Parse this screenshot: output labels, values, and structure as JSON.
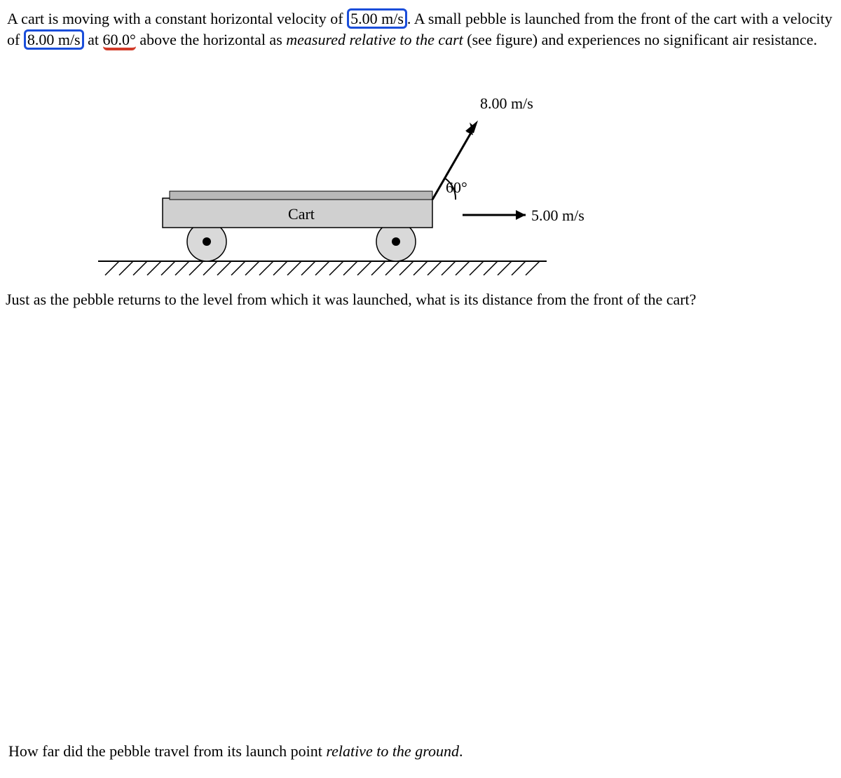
{
  "problem": {
    "p1_pre": "A cart is moving with a constant horizontal velocity of ",
    "v_cart": "5.00 m/s",
    "p1_mid1": ". A small pebble is launched from the front of the cart with a velocity of ",
    "v_pebble": "8.00 m/s",
    "p1_mid2": " at ",
    "angle_text": "60.0°",
    "p1_mid3": " above the horizontal as ",
    "relative_phrase": "measured relative to the cart",
    "p1_end": " (see figure) and experiences no significant air resistance.",
    "q1_a": "Just as the pebble returns to the level from which it was launched, what is its distance from the front of the cart?",
    "q2_a": "How far did the pebble travel from its launch point ",
    "q2_em": "relative to the ground",
    "q2_b": "."
  },
  "figure": {
    "cart_label": "Cart",
    "angle_label": "60°",
    "top_label": "8.00 m/s",
    "right_label": "5.00 m/s"
  }
}
